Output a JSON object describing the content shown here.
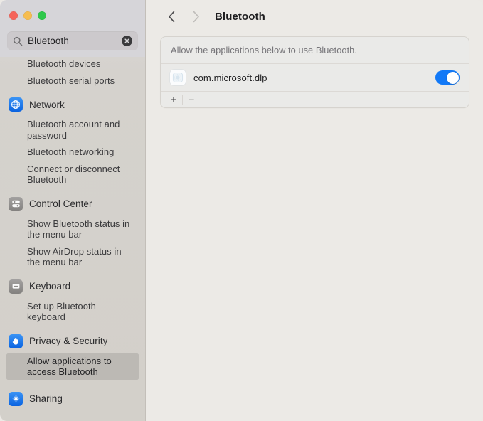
{
  "window": {
    "traffic_lights": [
      {
        "name": "close",
        "color": "#f5655b"
      },
      {
        "name": "minimize",
        "color": "#f6bd50"
      },
      {
        "name": "maximize",
        "color": "#2fc84b"
      }
    ]
  },
  "search": {
    "value": "Bluetooth",
    "placeholder": "Search",
    "icon": "search-icon",
    "clear_icon": "clear-circle-icon"
  },
  "sidebar": {
    "results": [
      {
        "type": "sub",
        "label": "Bluetooth devices",
        "clipped": true,
        "selected": false
      },
      {
        "type": "sub",
        "label": "Bluetooth serial ports",
        "selected": false
      },
      {
        "type": "group",
        "label": "Network",
        "icon": "globe-icon",
        "icon_color": "#1069e3",
        "items": [
          {
            "label": "Bluetooth account and password",
            "selected": false
          },
          {
            "label": "Bluetooth networking",
            "selected": false
          },
          {
            "label": "Connect or disconnect Bluetooth",
            "selected": false
          }
        ]
      },
      {
        "type": "group",
        "label": "Control Center",
        "icon": "control-center-icon",
        "icon_color": "#8e8c8a",
        "items": [
          {
            "label": "Show Bluetooth status in the menu bar",
            "selected": false
          },
          {
            "label": "Show AirDrop status in the menu bar",
            "selected": false
          }
        ]
      },
      {
        "type": "group",
        "label": "Keyboard",
        "icon": "keyboard-icon",
        "icon_color": "#8e8c8a",
        "items": [
          {
            "label": "Set up Bluetooth keyboard",
            "selected": false
          }
        ]
      },
      {
        "type": "group",
        "label": "Privacy & Security",
        "icon": "hand-raised-icon",
        "icon_color": "#1069e3",
        "items": [
          {
            "label": "Allow applications to access Bluetooth",
            "selected": true
          }
        ]
      },
      {
        "type": "group",
        "label": "Sharing",
        "icon": "sharing-icon",
        "icon_color": "#1069e3",
        "items": []
      }
    ]
  },
  "main": {
    "nav": {
      "back_icon": "chevron-left-icon",
      "back_enabled": true,
      "forward_icon": "chevron-right-icon",
      "forward_enabled": false
    },
    "title": "Bluetooth",
    "card": {
      "note": "Allow the applications below to use Bluetooth.",
      "apps": [
        {
          "name": "com.microsoft.dlp",
          "icon": "generic-app-icon",
          "enabled": true
        }
      ],
      "footer": {
        "add_label": "+",
        "add_enabled": true,
        "remove_label": "−",
        "remove_enabled": false
      }
    }
  },
  "colors": {
    "accent": "#1279f7",
    "sidebar_bg": "#d5d2cd",
    "main_bg": "#eceae6",
    "card_bg": "#eaeae8",
    "selected_bg": "#bcb9b4"
  }
}
